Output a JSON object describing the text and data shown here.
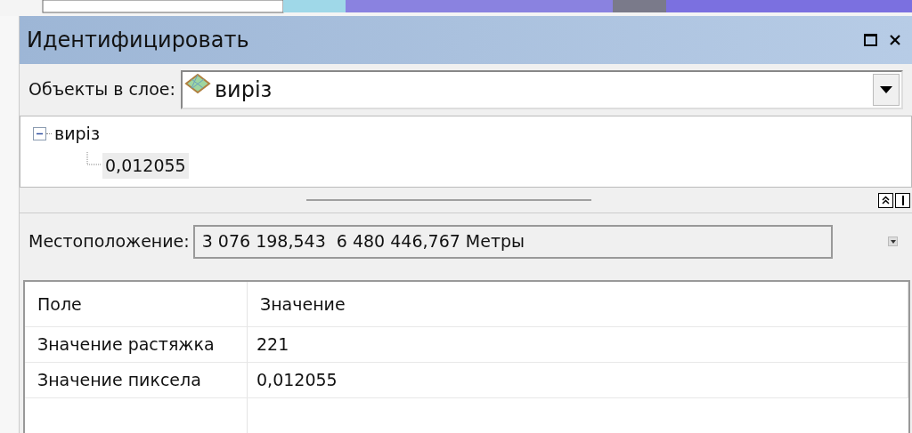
{
  "window": {
    "title": "Идентифицировать"
  },
  "layer_selector": {
    "label": "Объекты в слое:",
    "value": "виріз"
  },
  "tree": [
    {
      "label": "виріз",
      "expanded": true,
      "selected": false,
      "children": [
        {
          "label": "0,012055",
          "selected": true
        }
      ]
    }
  ],
  "location": {
    "label": "Местоположение:",
    "value": "3 076 198,543  6 480 446,767 Метры"
  },
  "table": {
    "columns": [
      "Поле",
      "Значение"
    ],
    "rows": [
      [
        "Значение растяжка",
        "221"
      ],
      [
        "Значение пиксела",
        "0,012055"
      ]
    ]
  }
}
